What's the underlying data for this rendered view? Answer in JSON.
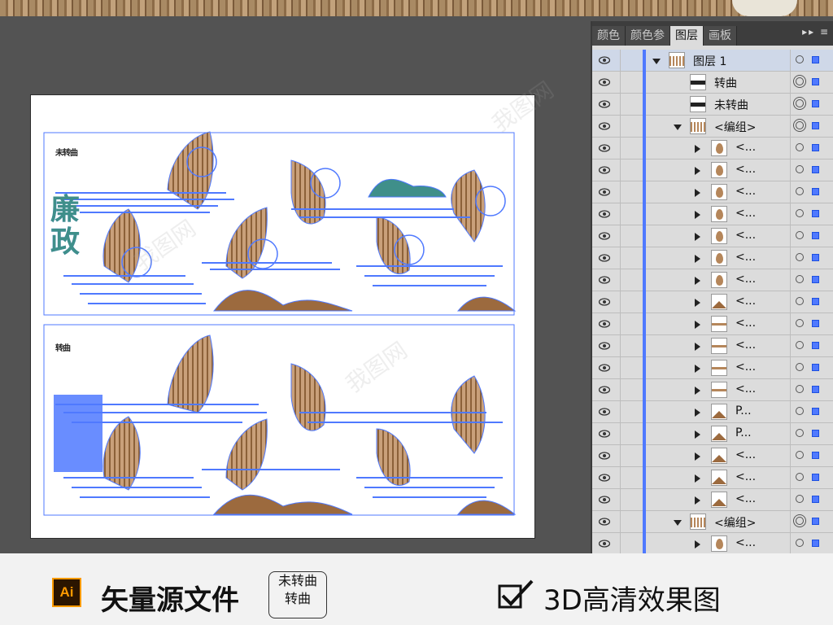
{
  "panel": {
    "tabs": [
      "颜色",
      "颜色参",
      "图层",
      "画板"
    ],
    "active_tab": "图层",
    "menu_glyph": "▸▸ ≡"
  },
  "artboard": {
    "label_top": "未转曲",
    "label_bottom": "转曲",
    "calligraphy": "廉政"
  },
  "layers": [
    {
      "name": "图层 1",
      "indent": 0,
      "expand": "down",
      "thumb": "layer"
    },
    {
      "name": "转曲",
      "indent": 1,
      "expand": "none",
      "thumb": "text"
    },
    {
      "name": "未转曲",
      "indent": 1,
      "expand": "none",
      "thumb": "text"
    },
    {
      "name": "<编组>",
      "indent": 1,
      "expand": "down",
      "thumb": "group"
    },
    {
      "name": "<...",
      "indent": 2,
      "expand": "right",
      "thumb": "leaf"
    },
    {
      "name": "<...",
      "indent": 2,
      "expand": "right",
      "thumb": "leaf"
    },
    {
      "name": "<...",
      "indent": 2,
      "expand": "right",
      "thumb": "leaf"
    },
    {
      "name": "<...",
      "indent": 2,
      "expand": "right",
      "thumb": "leaf"
    },
    {
      "name": "<...",
      "indent": 2,
      "expand": "right",
      "thumb": "leaf"
    },
    {
      "name": "<...",
      "indent": 2,
      "expand": "right",
      "thumb": "leaf"
    },
    {
      "name": "<...",
      "indent": 2,
      "expand": "right",
      "thumb": "leaf"
    },
    {
      "name": "<...",
      "indent": 2,
      "expand": "right",
      "thumb": "mountain"
    },
    {
      "name": "<...",
      "indent": 2,
      "expand": "right",
      "thumb": "strip"
    },
    {
      "name": "<...",
      "indent": 2,
      "expand": "right",
      "thumb": "strip"
    },
    {
      "name": "<...",
      "indent": 2,
      "expand": "right",
      "thumb": "strip"
    },
    {
      "name": "<...",
      "indent": 2,
      "expand": "right",
      "thumb": "strip"
    },
    {
      "name": "P...",
      "indent": 2,
      "expand": "right",
      "thumb": "mountain"
    },
    {
      "name": "P...",
      "indent": 2,
      "expand": "right",
      "thumb": "mountain"
    },
    {
      "name": "<...",
      "indent": 2,
      "expand": "right",
      "thumb": "mountain"
    },
    {
      "name": "<...",
      "indent": 2,
      "expand": "right",
      "thumb": "mountain"
    },
    {
      "name": "<...",
      "indent": 2,
      "expand": "right",
      "thumb": "mountain"
    },
    {
      "name": "<编组>",
      "indent": 1,
      "expand": "down",
      "thumb": "group"
    },
    {
      "name": "<...",
      "indent": 2,
      "expand": "right",
      "thumb": "leaf"
    }
  ],
  "footer": {
    "ai_icon": "Ai",
    "source_file": "矢量源文件",
    "badge_line1": "未转曲",
    "badge_line2": "转曲",
    "effect": "3D高清效果图"
  },
  "watermark": "我图网",
  "colors": {
    "selection": "#4f79ff",
    "wood": "#b5865a",
    "teal": "#3f8f8a",
    "panel_bg": "#dcdcdc",
    "canvas_bg": "#535353",
    "ai_orange": "#ff9a00"
  }
}
